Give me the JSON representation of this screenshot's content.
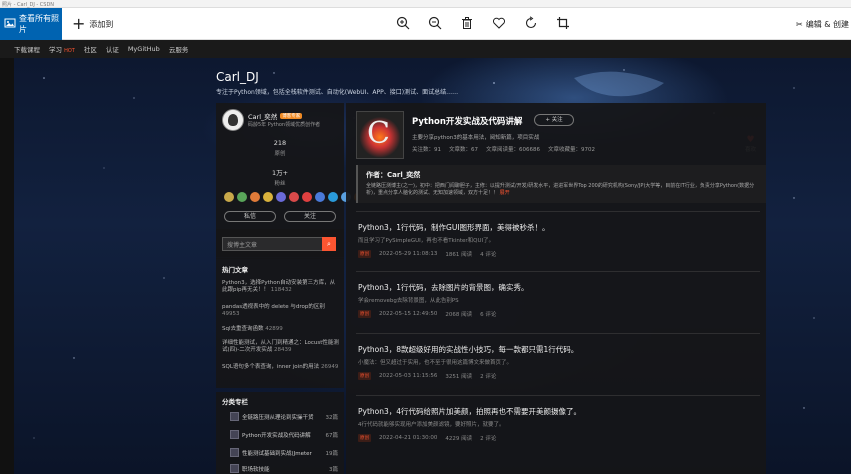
{
  "window": {
    "title": "照片 - Carl_DJ - CSDN"
  },
  "toolbar": {
    "see_all": "查看所有照片",
    "add_to": "添加到",
    "icons": [
      "zoom-in-icon",
      "zoom-out-icon",
      "delete-icon",
      "heart-icon",
      "rotate-icon",
      "crop-icon"
    ],
    "edit_create": "编辑 & 创建"
  },
  "site_nav": {
    "items": [
      "下载课程",
      "学习",
      "社区",
      "认证",
      "MyGitHub",
      "云服务"
    ],
    "hot_badge": "HOT"
  },
  "blog": {
    "title": "Carl_DJ",
    "subtitle": "专注于Python领域，包括全栈软件测试、自动化(WebUI、APP、接口)测试、面试总结……",
    "favorite_label": "喜欢"
  },
  "profile": {
    "name": "Carl_奕然",
    "badge": "博客专家",
    "info": "码龄5年  Python领域优质创作者",
    "stats": [
      {
        "num": "218",
        "label": "原创"
      },
      {
        "num": "1万+",
        "label": "粉丝"
      }
    ],
    "medal_colors": [
      "#c9a94a",
      "#59a55a",
      "#e07b39",
      "#d9b23c",
      "#6a6ad9",
      "#d94a4a",
      "#e04040",
      "#4a7ad9",
      "#2a9ad9",
      "#5aa0e0",
      "#ff7a1a"
    ],
    "message_btn": "私信",
    "follow_btn": "关注"
  },
  "search": {
    "placeholder": "搜博主文章"
  },
  "hot_articles": {
    "title": "热门文章",
    "items": [
      {
        "text": "Python3，选择Python自动安装第三方库，从此跟pip再无关！！",
        "views": "118432"
      },
      {
        "text": "pandas透视表中的 delete 与drop的区别",
        "views": "49953"
      },
      {
        "text": "Sql去重查询函数",
        "views": "42899"
      },
      {
        "text": "详细性能测试，从入门到精通之：Locust性能测试(四)-二次开发实战",
        "views": "28439"
      },
      {
        "text": "SQL语句多个表查询，inner join的用法",
        "views": "26949"
      }
    ]
  },
  "categories": {
    "title": "分类专栏",
    "items": [
      {
        "name": "全链路压测从理论到实操干货",
        "count": "32篇"
      },
      {
        "name": "Python开发实战及代码讲解",
        "count": "67篇"
      },
      {
        "name": "性能测试基础到实战(Jmeter",
        "count": "19篇"
      },
      {
        "name": "职场软技能",
        "count": "3篇"
      }
    ]
  },
  "column": {
    "title": "Python开发实战及代码讲解",
    "follow_btn": "+ 关注",
    "desc": "主要分享python3的基本用法，阅知新篇，项目实战",
    "stats": [
      "关注数：91",
      "文章数：67",
      "文章阅读量：606686",
      "文章收藏量：9702"
    ]
  },
  "author": {
    "label": "作者：Carl_奕然",
    "intro": "全链路压测博主(之一)，初中：把西门闻聊胆子，主修：以提升测试/开发/研发水平，进进军世界Top 200的研究机构(Sony/JP)大学等，目前在IT行业，负责分享Python(数据分析)，重点分享人脑化的测试、无知加速领域，双方十足！！",
    "more": "展开"
  },
  "articles": [
    {
      "title": "Python3，1行代码，制作GUI图形界面，美得被秒杀！。",
      "summary": "而且学习了PySimpleGUI，再也不看Tkinter和QUI了。",
      "tag": "原创",
      "date": "2022-05-29 11:08:13",
      "reads": "1861 阅读",
      "comments": "4 评论"
    },
    {
      "title": "Python3，1行代码，去除图片的背景图，确实秀。",
      "summary": "学会removebg去除背景图，从此告别PS",
      "tag": "原创",
      "date": "2022-05-15 12:49:50",
      "reads": "2068 阅读",
      "comments": "6 评论"
    },
    {
      "title": "Python3，8款超级好用的实战性小技巧，每一款都只需1行代码。",
      "summary": "小魔法：但又超过于实用，也不至于很用这篇博文来做首页了。",
      "tag": "原创",
      "date": "2022-05-03 11:15:56",
      "reads": "3251 阅读",
      "comments": "2 评论"
    },
    {
      "title": "Python3，4行代码给照片加美颜，拍照再也不需要开美颜摄像了。",
      "summary": "4行代码就能够实现用户添加美颜滤镜，要好照片，就要了。",
      "tag": "原创",
      "date": "2022-04-21 01:30:00",
      "reads": "4229 阅读",
      "comments": "2 评论"
    }
  ]
}
